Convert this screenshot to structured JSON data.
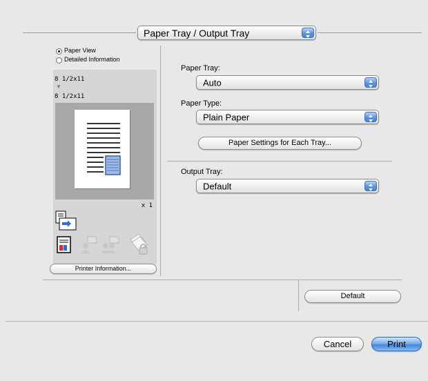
{
  "section_popup": {
    "value": "Paper Tray / Output Tray"
  },
  "view": {
    "options": [
      "Paper View",
      "Detailed Information"
    ],
    "selected": "Paper View"
  },
  "preview": {
    "input_size": "8 1/2x11",
    "output_size": "8 1/2x11",
    "copies": "x 1"
  },
  "printer_info_button": "Printer Information...",
  "paper_tray": {
    "label": "Paper Tray:",
    "value": "Auto"
  },
  "paper_type": {
    "label": "Paper Type:",
    "value": "Plain Paper"
  },
  "paper_settings_button": "Paper Settings for Each Tray...",
  "output_tray": {
    "label": "Output Tray:",
    "value": "Default"
  },
  "default_button": "Default",
  "cancel_button": "Cancel",
  "print_button": "Print",
  "colors": {
    "accent": "#4a82d4",
    "preview_bg": "#d6d6d6",
    "paper_area": "#a8a8a8"
  }
}
